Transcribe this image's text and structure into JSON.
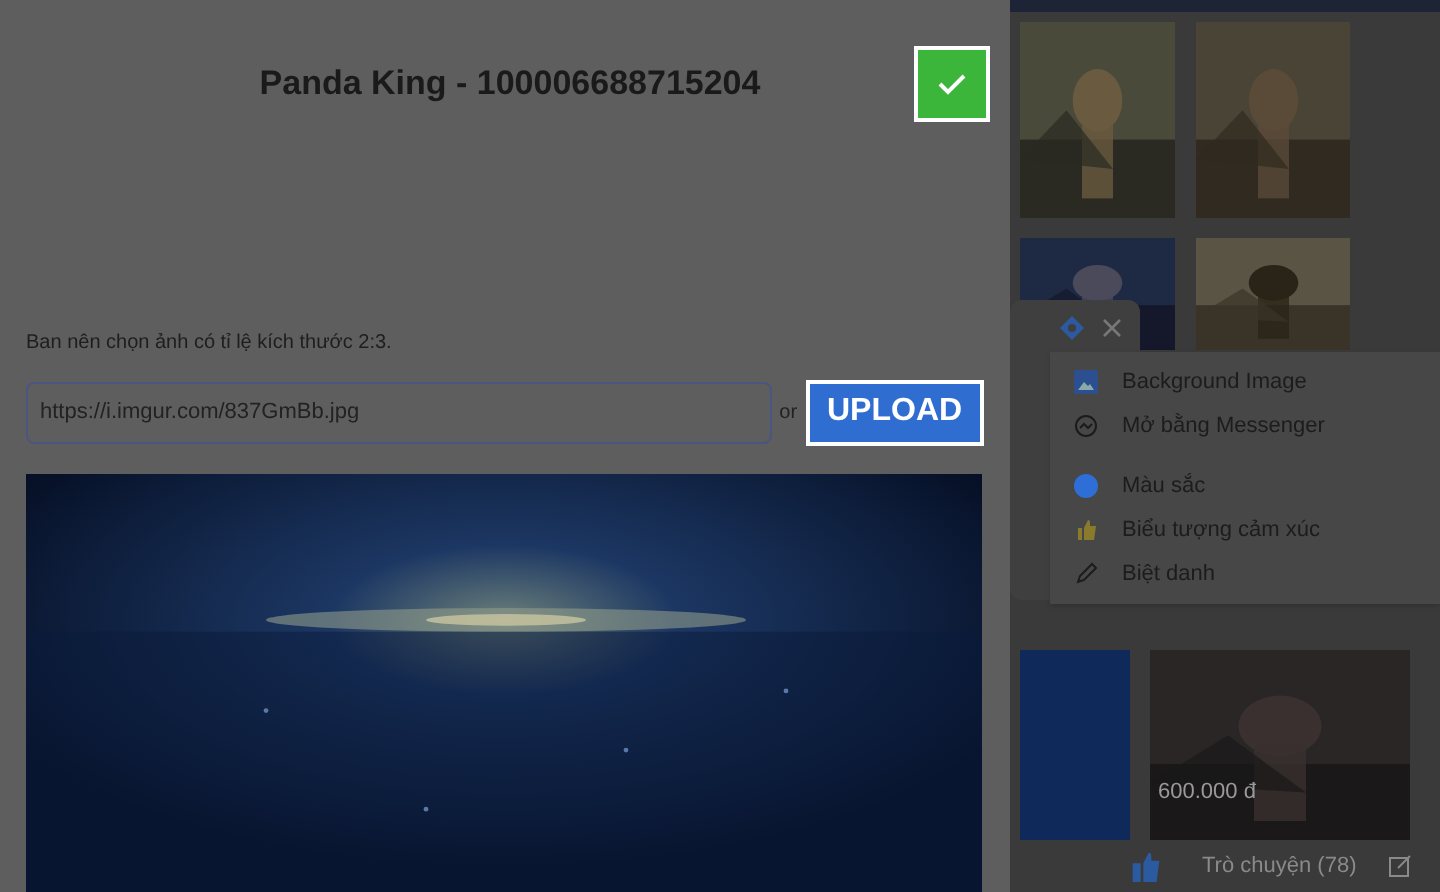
{
  "dialog": {
    "title": "Panda King - 100006688715204",
    "hint": "Ban nên chọn ảnh có tỉ lệ kích thước 2:3.",
    "url_field": {
      "value": "https://i.imgur.com/837GmBb.jpg"
    },
    "or_label": "or",
    "upload_button": "UPLOAD"
  },
  "menu": {
    "items": [
      {
        "label": "Background Image"
      },
      {
        "label": "Mở bằng Messenger"
      },
      {
        "label": "Màu sắc",
        "color": "#2d6fd6"
      },
      {
        "label": "Biểu tượng cảm xúc"
      },
      {
        "label": "Biệt danh"
      }
    ]
  },
  "listing": {
    "price": "600.000 đ"
  },
  "chat_bar": {
    "label": "Trò chuyện (78)"
  }
}
